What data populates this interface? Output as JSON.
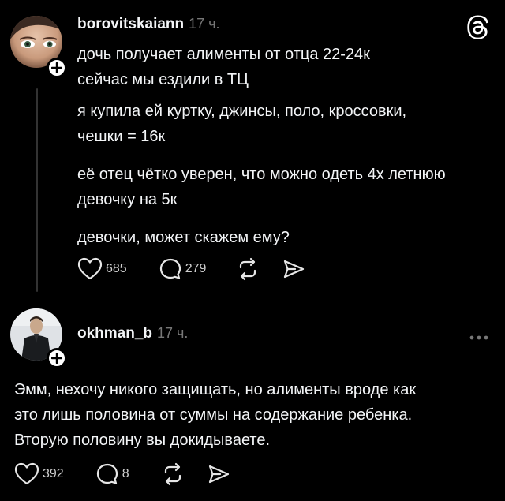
{
  "post": {
    "username": "borovitskaiann",
    "time": "17 ч.",
    "lines": [
      "дочь получает алименты от отца 22-24к",
      "сейчас мы ездили в ТЦ",
      "я купила ей куртку, джинсы, поло, кроссовки,",
      "чешки = 16к",
      "её отец чётко уверен, что можно одеть 4х летнюю",
      "девочку на 5к",
      "девочки, может скажем ему?"
    ],
    "likes": "685",
    "replies": "279"
  },
  "reply": {
    "username": "okhman_b",
    "time": "17 ч.",
    "lines": [
      "Эмм, нехочу никого защищать, но алименты вроде как",
      "это лишь половина от суммы на содержание ребенка.",
      "Вторую половину вы докидываете."
    ],
    "likes": "392",
    "replies": "8"
  },
  "icons": {
    "app_logo": "threads-logo-icon",
    "more": "more-dots-icon",
    "like": "heart-icon",
    "reply": "comment-icon",
    "repost": "repost-icon",
    "share": "send-icon",
    "follow": "plus-icon"
  },
  "colors": {
    "background": "#000000",
    "text": "#f3f5f7",
    "muted": "#777777"
  }
}
